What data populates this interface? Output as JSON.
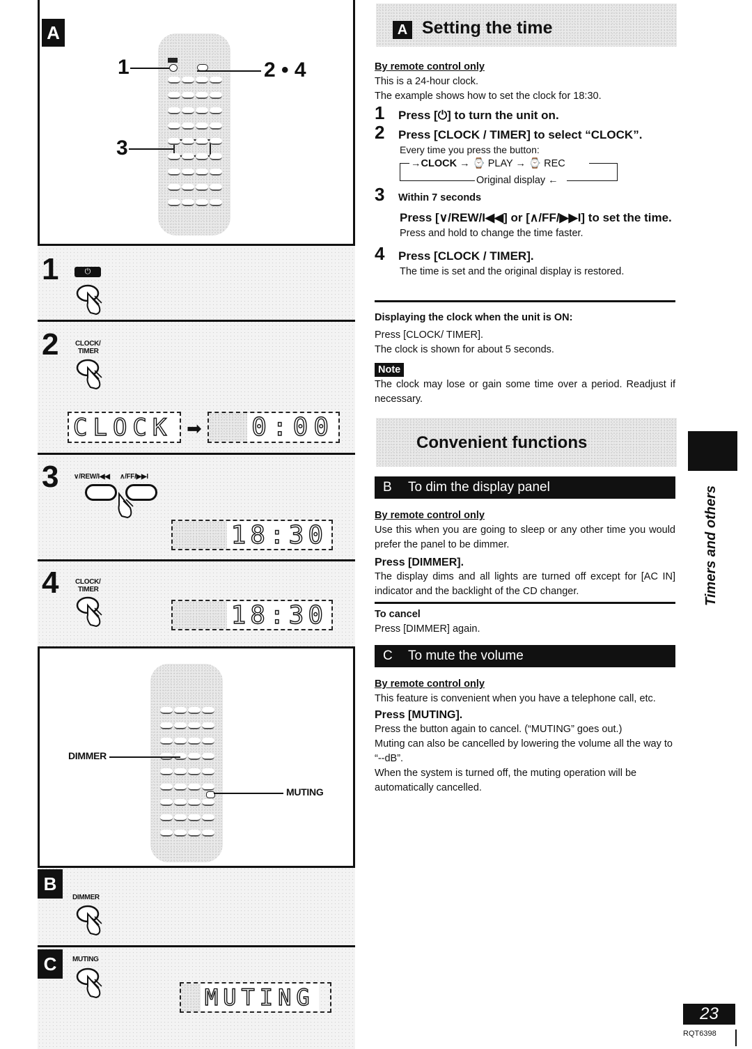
{
  "left": {
    "panel_a": {
      "letter": "A",
      "callouts": [
        "1",
        "2 • 4",
        "3"
      ]
    },
    "steps": [
      {
        "num": "1",
        "button_label": "⏻"
      },
      {
        "num": "2",
        "button_label_1": "CLOCK/",
        "button_label_2": "TIMER",
        "display_from": "CLOCK",
        "display_to": "0:00"
      },
      {
        "num": "3",
        "button_label_left": "∨/REW/I◀◀",
        "button_label_right": "∧/FF/▶▶I",
        "display": "18:30"
      },
      {
        "num": "4",
        "button_label_1": "CLOCK/",
        "button_label_2": "TIMER",
        "display": "18:30"
      }
    ],
    "panel_bc": {
      "dimmer_callout": "DIMMER",
      "muting_callout": "MUTING"
    },
    "step_b": {
      "letter": "B",
      "button_label": "DIMMER"
    },
    "step_c": {
      "letter": "C",
      "button_label": "MUTING",
      "display": "MUTING"
    }
  },
  "right": {
    "section_a": {
      "letter": "A",
      "title": "Setting the time",
      "subhead": "By remote control only",
      "intro_1": "This is a 24-hour clock.",
      "intro_2": "The example shows how to set the clock for 18:30.",
      "step1": {
        "num": "1",
        "text": "Press [⏻] to turn the unit on."
      },
      "step2": {
        "num": "2",
        "text": "Press [CLOCK / TIMER] to select “CLOCK”.",
        "note": "Every time you press the button:",
        "cycle": [
          "CLOCK",
          "⌚ PLAY",
          "⌚ REC"
        ],
        "cycle_return": "Original display"
      },
      "step3": {
        "num": "3",
        "pre": "Within 7 seconds",
        "text": "Press [∨/REW/I◀◀] or [∧/FF/▶▶I] to set the time.",
        "note": "Press and hold to change the time faster."
      },
      "step4": {
        "num": "4",
        "text": "Press [CLOCK / TIMER].",
        "note": "The time is set and the original display is restored."
      },
      "display_on_head": "Displaying the clock when the unit is ON:",
      "display_on_1": "Press [CLOCK/ TIMER].",
      "display_on_2": "The clock is shown for about 5 seconds.",
      "note_label": "Note",
      "note_text": "The clock may lose or gain some time over a period. Readjust if necessary."
    },
    "convenient_title": "Convenient functions",
    "section_b": {
      "letter": "B",
      "title": "To dim the display panel",
      "subhead": "By remote control only",
      "intro": "Use this when you are going to sleep or any other time you would prefer the panel to be dimmer.",
      "press": "Press [DIMMER].",
      "desc": "The display dims and all lights are turned off except for [AC IN] indicator and the backlight of the CD changer.",
      "cancel_head": "To cancel",
      "cancel_text": "Press [DIMMER] again."
    },
    "section_c": {
      "letter": "C",
      "title": "To mute the volume",
      "subhead": "By remote control only",
      "intro": "This feature is convenient when you have a telephone call, etc.",
      "press": "Press [MUTING].",
      "desc_1": "Press the button again to cancel. (“MUTING” goes out.)",
      "desc_2": "Muting can also be cancelled by lowering the volume all the way to “--dB”.",
      "desc_3": "When the system is turned off, the muting operation will be automatically cancelled."
    }
  },
  "side_tab": {
    "label": "Timers and others"
  },
  "footer": {
    "page_number": "23",
    "doc_code": "RQT6398"
  }
}
